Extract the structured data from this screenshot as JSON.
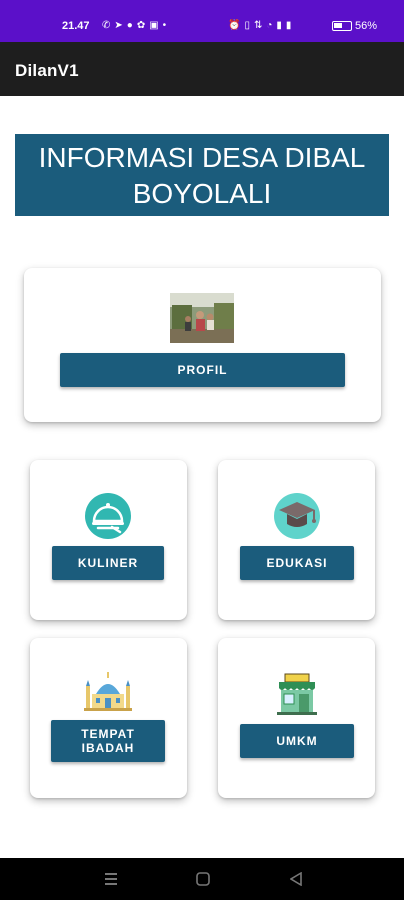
{
  "statusbar": {
    "time": "21.47",
    "battery_text": "56%",
    "battery_level": 0.56
  },
  "app": {
    "title": "DilanV1"
  },
  "banner": {
    "line1": "INFORMASI DESA DIBAL",
    "line2": "BOYOLALI"
  },
  "cards": {
    "profil": {
      "button_label": "PROFIL"
    },
    "kuliner": {
      "button_label": "KULINER",
      "icon": "food-tray-icon"
    },
    "edukasi": {
      "button_label": "EDUKASI",
      "icon": "graduation-cap-icon"
    },
    "ibadah": {
      "button_label": "TEMPAT\nIBADAH",
      "icon": "mosque-icon"
    },
    "umkm": {
      "button_label": "UMKM",
      "icon": "shop-icon"
    }
  },
  "colors": {
    "status_bar": "#5b10c9",
    "app_bar": "#1e1e1e",
    "primary": "#1b5c7c",
    "icon_teal": "#31b7b1"
  }
}
